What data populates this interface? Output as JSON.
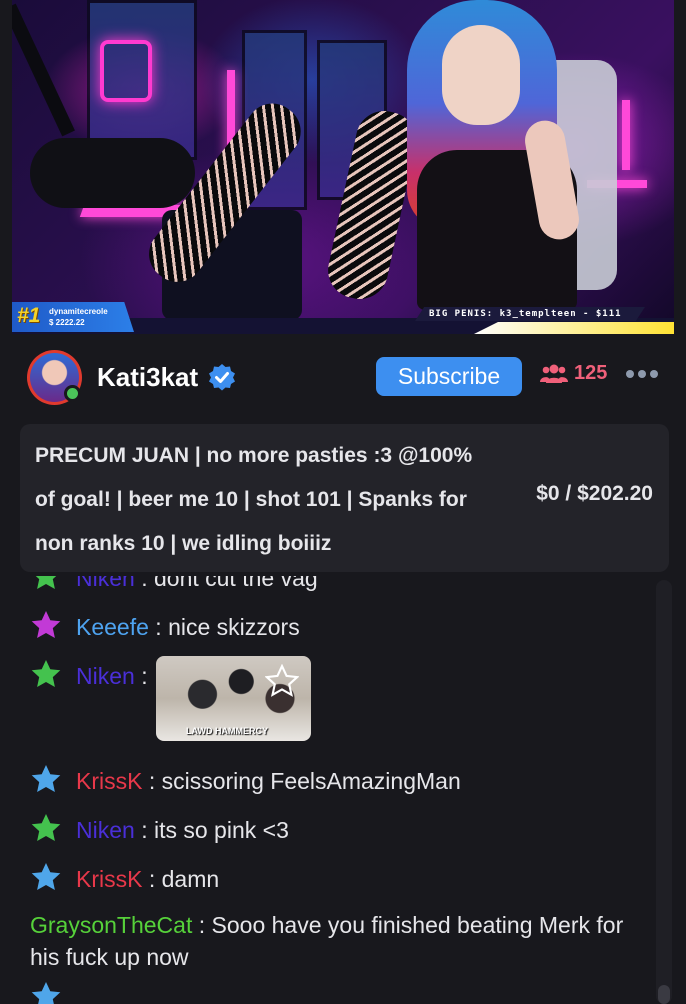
{
  "stream": {
    "overlay_ticker": "BIG PENIS: k3_templteen - $111",
    "rank_badge": {
      "rank": "#1",
      "name": "dynamitecreole",
      "amount": "$ 2222.22"
    }
  },
  "channel": {
    "name": "Kati3kat",
    "verified_icon": "verified-check-icon",
    "subscribe_label": "Subscribe",
    "viewer_count": "125",
    "viewer_icon": "users-icon",
    "more_icon": "more-horizontal-icon",
    "online_color": "#4bc45a"
  },
  "goal": {
    "line1": "PRECUM JUAN | no more pasties :3 @100%",
    "line2": "of goal! | beer me 10 | shot 101 | Spanks for",
    "line3": "non ranks 10 | we idling boiiiz",
    "progress": "$0 / $202.20"
  },
  "chat": {
    "messages": [
      {
        "user": "Niken",
        "user_color": "#4a2fd8",
        "star_color": "#44c24e",
        "text": " : dont cut the vag"
      },
      {
        "user": "Keeefe",
        "user_color": "#4ea3f0",
        "star_color": "#c23ad6",
        "text": " : nice skizzors"
      },
      {
        "user": "Niken",
        "user_color": "#4a2fd8",
        "star_color": "#44c24e",
        "text": " :"
      },
      {
        "user": "KrissK",
        "user_color": "#e8384a",
        "star_color": "#4fa6ea",
        "text": " : scissoring  FeelsAmazingMan"
      },
      {
        "user": "Niken",
        "user_color": "#4a2fd8",
        "star_color": "#44c24e",
        "text": " : its so pink <3"
      },
      {
        "user": "KrissK",
        "user_color": "#e8384a",
        "star_color": "#4fa6ea",
        "text": " : damn"
      },
      {
        "user": "GraysonTheCat",
        "user_color": "#56d13a",
        "text": " : Sooo have you finished beating Merk for his fuck up now"
      }
    ],
    "sticker_caption": "LAWD HAMMERCY"
  }
}
